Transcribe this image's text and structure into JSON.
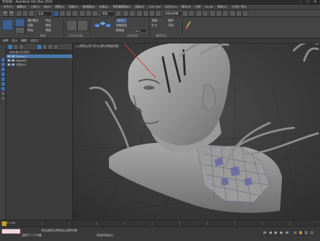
{
  "window": {
    "title": "无标题 - Autodesk 3ds Max 2019",
    "controls": [
      "–",
      "□",
      "✕"
    ]
  },
  "menubar": {
    "items": [
      "文件(F)",
      "编辑(E)",
      "工具(T)",
      "组(G)",
      "视图(V)",
      "创建(C)",
      "修改器(M)",
      "动画(A)",
      "图形编辑器(D)",
      "渲染(R)",
      "Civil View",
      "自定义(U)",
      "脚本(S)",
      "内容",
      "Arnold",
      "帮助(H)",
      "工作区: 默认"
    ]
  },
  "toolbar": {
    "undo_icon": "↶",
    "redo_icon": "↷",
    "selection_filter": "全部",
    "ref_coord": "视图",
    "named_selection": "创建选择集"
  },
  "ribbon": {
    "tabs": [
      "建模",
      "自由形式",
      "选择",
      "对象绘制",
      "填充"
    ],
    "group1": {
      "items": [
        "循环模式",
        "切割",
        "附加",
        "挤出",
        "倒角",
        "塌陷"
      ],
      "label": "编辑"
    },
    "group2": {
      "label": "几何体(全部)"
    },
    "group3": {
      "items": [
        "按顶点",
        "忽略背面",
        "按角度"
      ],
      "angle_value": "45.0",
      "label": "修改选择"
    },
    "group4": {
      "items": [
        "收缩",
        "扩大",
        "循环",
        "环形"
      ],
      "label": "编辑顶点"
    }
  },
  "subtabs": [
    "选择",
    "显示",
    "编辑",
    "自定义"
  ],
  "scene_explorer": {
    "header": "名称(按升序排序)",
    "rows": [
      {
        "name": "Scene0",
        "selected": true
      },
      {
        "name": "Object01",
        "selected": false
      },
      {
        "name": "头发001",
        "selected": false
      }
    ]
  },
  "viewport": {
    "label": "[+] [透视] [用户定义] [默认明暗处理]"
  },
  "statusbar": {
    "frame": "0 / 100",
    "selected": "选择了 1 个对象",
    "hint": "单击或单击并拖动以选择对象",
    "add_time_tag": "添加时间标记"
  },
  "colors": {
    "accent": "#4c78b0",
    "bg": "#3b3b3b",
    "viewport": "#383838"
  }
}
